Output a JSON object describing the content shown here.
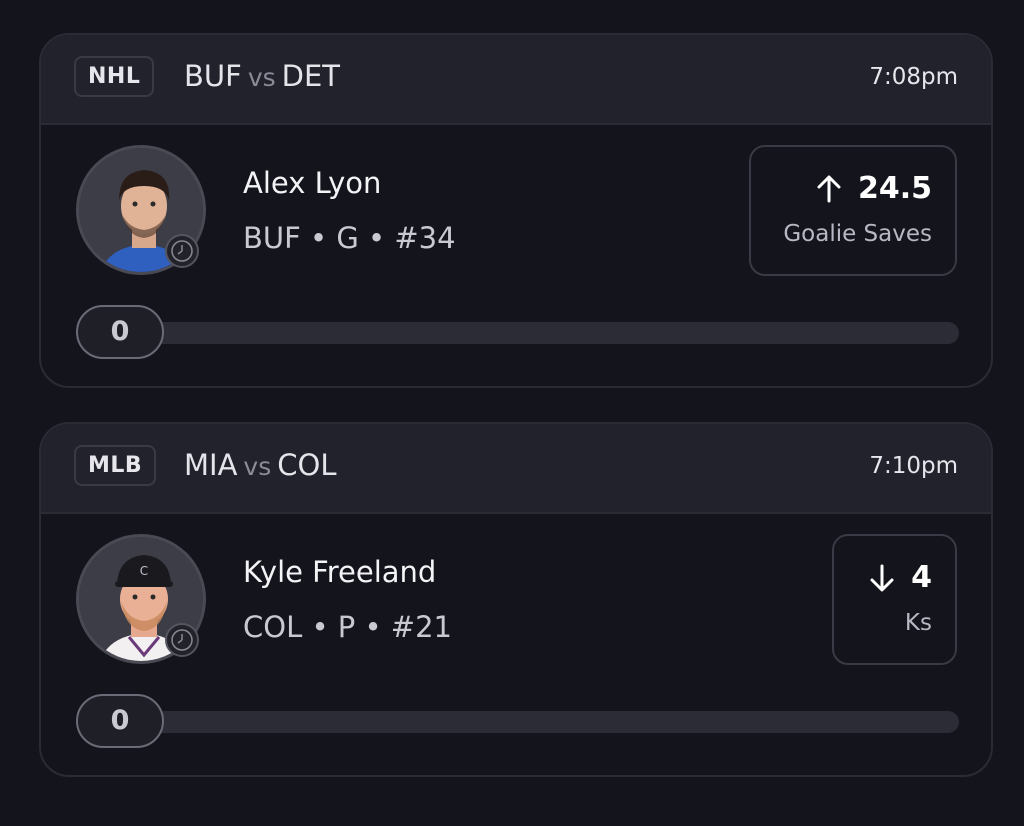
{
  "cards": [
    {
      "league": "NHL",
      "home_team": "BUF",
      "vs": "vs",
      "away_team": "DET",
      "time": "7:08pm",
      "player_name": "Alex Lyon",
      "player_meta": "BUF • G • #34",
      "prop_direction": "over",
      "prop_value": "24.5",
      "prop_label": "Goalie Saves",
      "progress_value": "0",
      "progress_fraction": 0
    },
    {
      "league": "MLB",
      "home_team": "MIA",
      "vs": "vs",
      "away_team": "COL",
      "time": "7:10pm",
      "player_name": "Kyle Freeland",
      "player_meta": "COL • P • #21",
      "prop_direction": "under",
      "prop_value": "4",
      "prop_label": "Ks",
      "progress_value": "0",
      "progress_fraction": 0
    }
  ],
  "icons": {
    "over": "arrow-up-icon",
    "under": "arrow-down-icon",
    "clock": "clock-icon"
  }
}
